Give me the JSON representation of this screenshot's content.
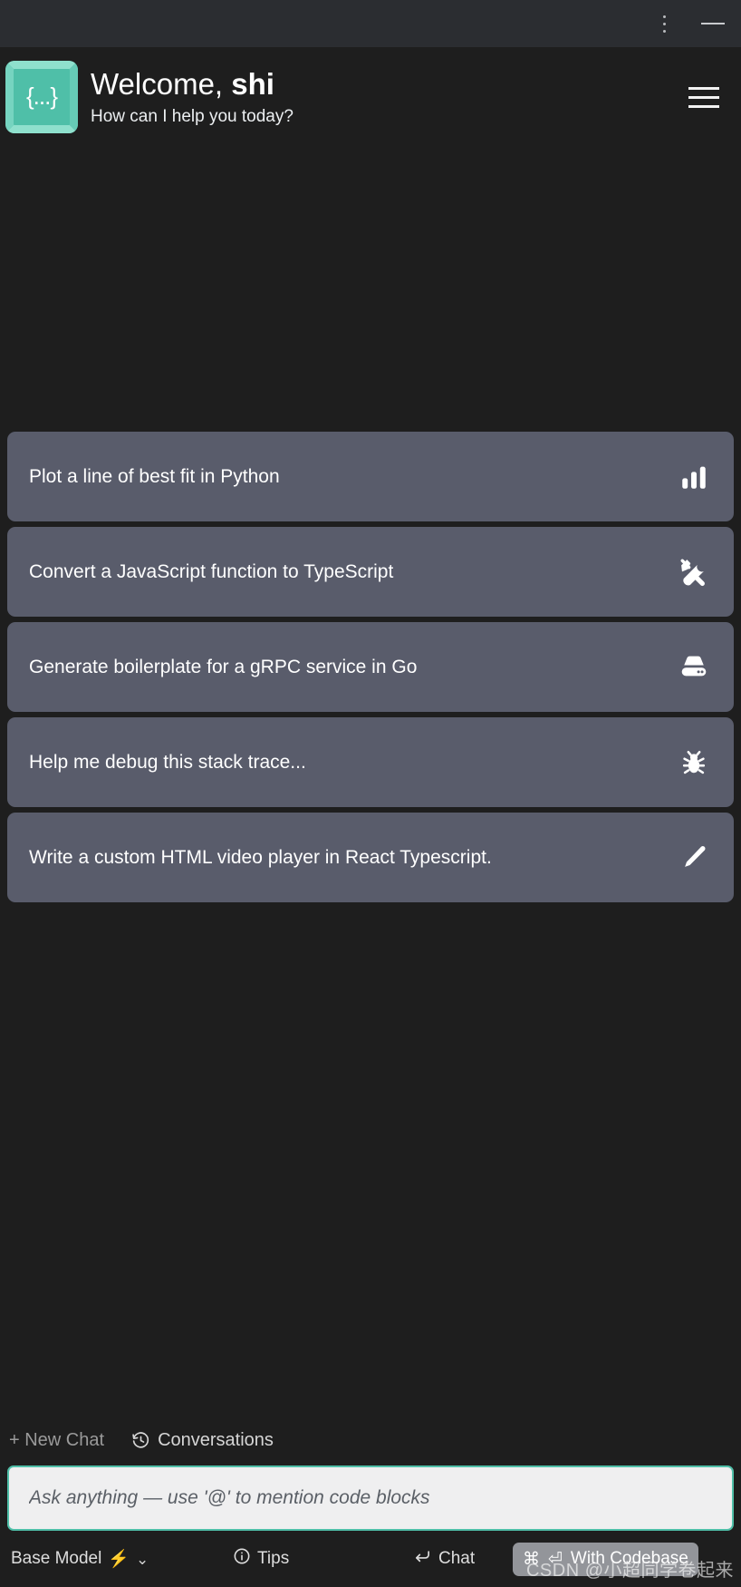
{
  "titlebar": {
    "menu_icon": "kebab-menu-icon",
    "minimize_icon": "minimize-icon"
  },
  "header": {
    "logo_glyph": "{...}",
    "logo_color": "#4fbfa8",
    "welcome_prefix": "Welcome, ",
    "welcome_user": "shi",
    "subtitle": "How can I help you today?",
    "menu_icon": "hamburger-icon"
  },
  "suggestions": [
    {
      "label": "Plot a line of best fit in Python",
      "icon": "bar-chart-icon"
    },
    {
      "label": "Convert a JavaScript function to TypeScript",
      "icon": "tools-icon"
    },
    {
      "label": "Generate boilerplate for a gRPC service in Go",
      "icon": "server-icon"
    },
    {
      "label": "Help me debug this stack trace...",
      "icon": "bug-icon"
    },
    {
      "label": "Write a custom HTML video player in React Typescript.",
      "icon": "pencil-icon"
    }
  ],
  "quicklinks": {
    "new_chat": "+ New Chat",
    "conversations": "Conversations",
    "conversations_icon": "history-clock-icon"
  },
  "composer": {
    "placeholder": "Ask anything — use '@' to mention code blocks",
    "value": "",
    "border_color": "#4fbfa8"
  },
  "statusbar": {
    "model_label": "Base Model",
    "model_bolt": "⚡",
    "model_chevron": "⌄",
    "tips_label": "Tips",
    "tips_icon": "info-circle-icon",
    "chat_label": "Chat",
    "chat_icon": "enter-key-icon",
    "codebase_label": "With Codebase",
    "codebase_cmd": "⌘",
    "codebase_enter": "⏎"
  },
  "watermark": {
    "text": "CSDN @小超同学卷起来"
  },
  "theme": {
    "app_background": "#1e1e1e",
    "titlebar_background": "#2b2d31",
    "card_background": "#595c6b",
    "accent": "#4fbfa8",
    "composer_background": "#efeff0"
  }
}
